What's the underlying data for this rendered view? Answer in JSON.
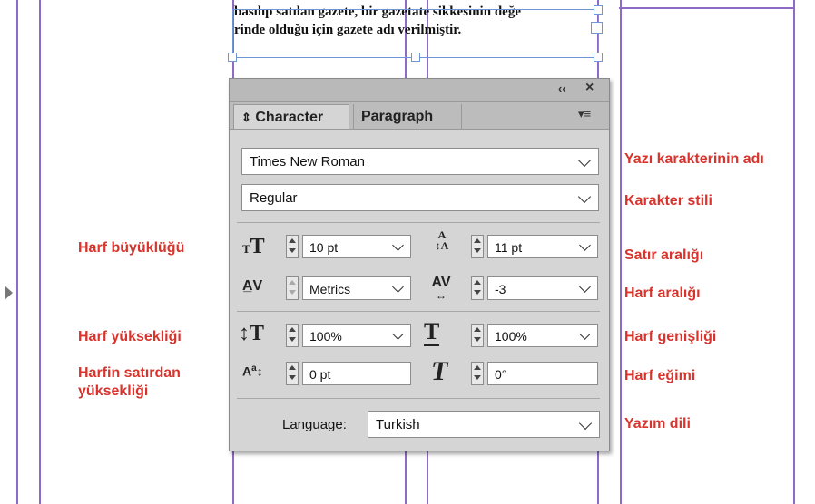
{
  "document": {
    "line1": "basılıp satılan gazete, bir gazetate sikkesinin değe",
    "line2": "rinde olduğu için gazete adı verilmiştir."
  },
  "panel": {
    "tabs": [
      {
        "label": "Character",
        "icon": "collapse-arrows-icon",
        "active": true
      },
      {
        "label": "Paragraph",
        "active": false
      }
    ],
    "titlebar": {
      "collapse_glyph": "‹‹",
      "close_glyph": "×",
      "menu_glyph": "▾≡"
    },
    "font_family": "Times New Roman",
    "font_style": "Regular",
    "font_size": "10 pt",
    "leading": "11 pt",
    "kerning": "Metrics",
    "tracking": "-3",
    "vertical_scale": "100%",
    "horizontal_scale": "100%",
    "baseline_shift": "0 pt",
    "skew": "0°",
    "language_label": "Language:",
    "language": "Turkish"
  },
  "annotations": {
    "font_name": "Yazı karakterinin adı",
    "font_style": "Karakter stili",
    "font_size": "Harf büyüklüğü",
    "leading": "Satır aralığı",
    "tracking": "Harf aralığı",
    "vertical_scale": "Harf yüksekliği",
    "horizontal_scale": "Harf genişliği",
    "baseline_shift_line1": "Harfin satırdan",
    "baseline_shift_line2": "yüksekliği",
    "skew": "Harf eğimi",
    "language": "Yazım dili"
  },
  "colors": {
    "annotation": "#d8332c",
    "guide": "#8e6bc4",
    "frame": "#6f95d6",
    "panel": "#d5d5d5"
  }
}
